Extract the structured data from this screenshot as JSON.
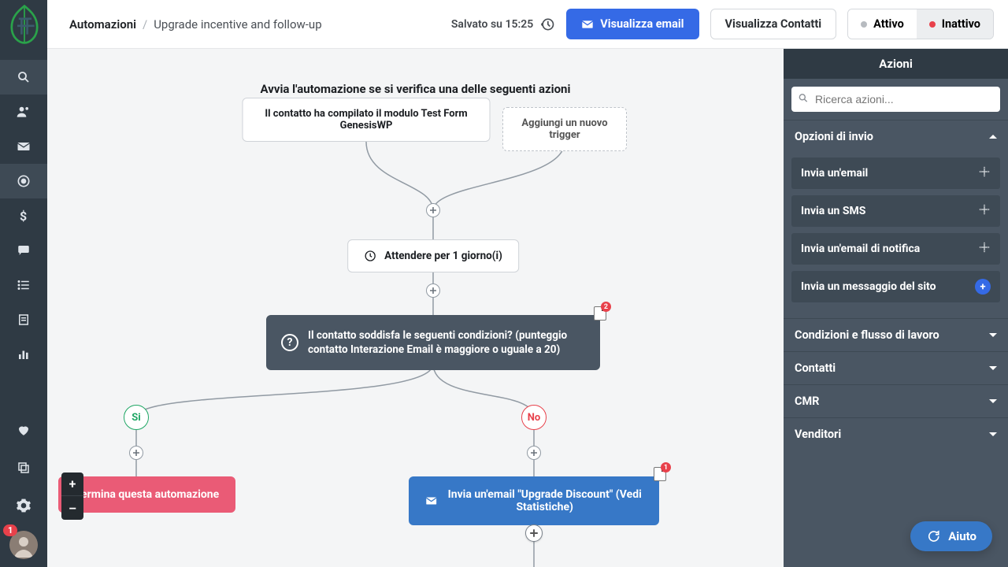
{
  "breadcrumb": {
    "root": "Automazioni",
    "sep": "/",
    "current": "Upgrade incentive and follow-up"
  },
  "saved": "Salvato su 15:25",
  "buttons": {
    "view_email": "Visualizza email",
    "view_contacts": "Visualizza Contatti",
    "active": "Attivo",
    "inactive": "Inattivo"
  },
  "right_panel": {
    "title": "Azioni",
    "search_placeholder": "Ricerca azioni...",
    "sections": [
      {
        "label": "Opzioni di invio",
        "open": true,
        "items": [
          {
            "label": "Invia un'email",
            "icon": "move"
          },
          {
            "label": "Invia un SMS",
            "icon": "move"
          },
          {
            "label": "Invia un'email di notifica",
            "icon": "move"
          },
          {
            "label": "Invia un messaggio del sito",
            "icon": "plus"
          }
        ]
      },
      {
        "label": "Condizioni e flusso di lavoro",
        "open": false
      },
      {
        "label": "Contatti",
        "open": false
      },
      {
        "label": "CMR",
        "open": false
      },
      {
        "label": "Venditori",
        "open": false
      }
    ]
  },
  "flow": {
    "title": "Avvia l'automazione se si verifica una delle seguenti azioni",
    "trigger": "Il contatto ha compilato il modulo Test Form GenesisWP",
    "add_trigger": "Aggiungi un nuovo trigger",
    "wait": "Attendere per 1 giorno(i)",
    "condition": "Il contatto soddisfa le seguenti condizioni? (punteggio contatto Interazione Email è maggiore o uguale a 20)",
    "cond_notes": "2",
    "yes": "Si",
    "no": "No",
    "terminate": "Termina questa automazione",
    "send_email": "Invia un'email \"Upgrade Discount\" (Vedi Statistiche)",
    "send_notes": "1"
  },
  "sidebar": {
    "notif": "1"
  },
  "help": "Aiuto",
  "zoom": {
    "in": "+",
    "out": "–"
  }
}
